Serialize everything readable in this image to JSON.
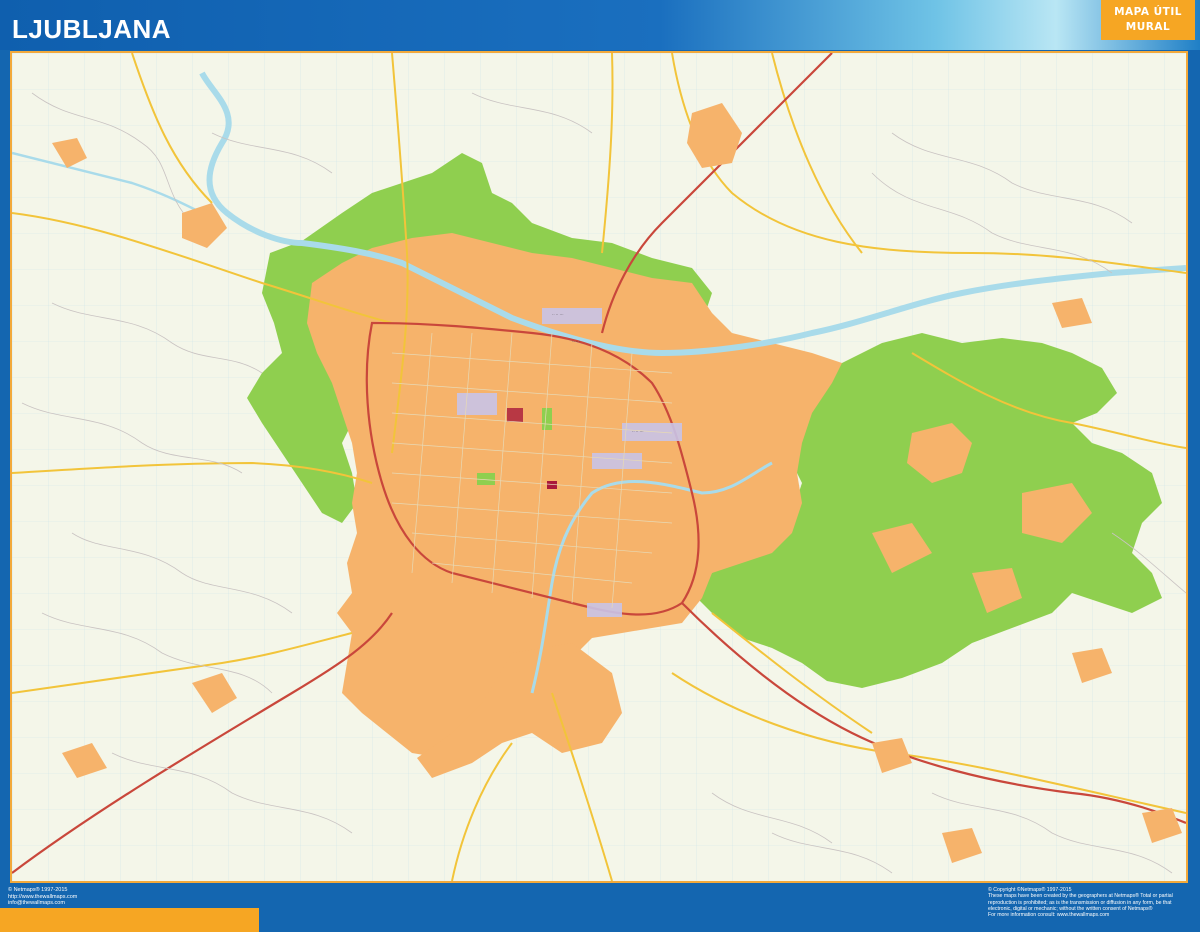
{
  "map": {
    "title": "LJUBLJANA",
    "badge_line1": "MAPA ÚTIL",
    "badge_line2": "MURAL"
  },
  "legend_colors": {
    "urban_area": "#f6b36b",
    "forest": "#8fcf4f",
    "water": "#a9dbea",
    "main_road": "#f2c43a",
    "motorway": "#c9473b",
    "background": "#f4f6e9",
    "frame": "#1466b0",
    "accent": "#f6a623"
  },
  "footer_left": {
    "line1": "© Netmaps® 1997-2015",
    "line2": "http://www.thewallmaps.com",
    "line3": "info@thewallmaps.com"
  },
  "footer_right": {
    "line1": "© Copyright ©Netmaps® 1997-2015",
    "line2": "These maps have been created by the geographers at Netmaps® Total or partial",
    "line3": "reproduction is prohibited; as is the transmission or diffusion in any form, be that",
    "line4": "electronic, digital or mechanic; without the written consent of Netmaps®",
    "line5": "For more information consult: www.thewallmaps.com"
  }
}
